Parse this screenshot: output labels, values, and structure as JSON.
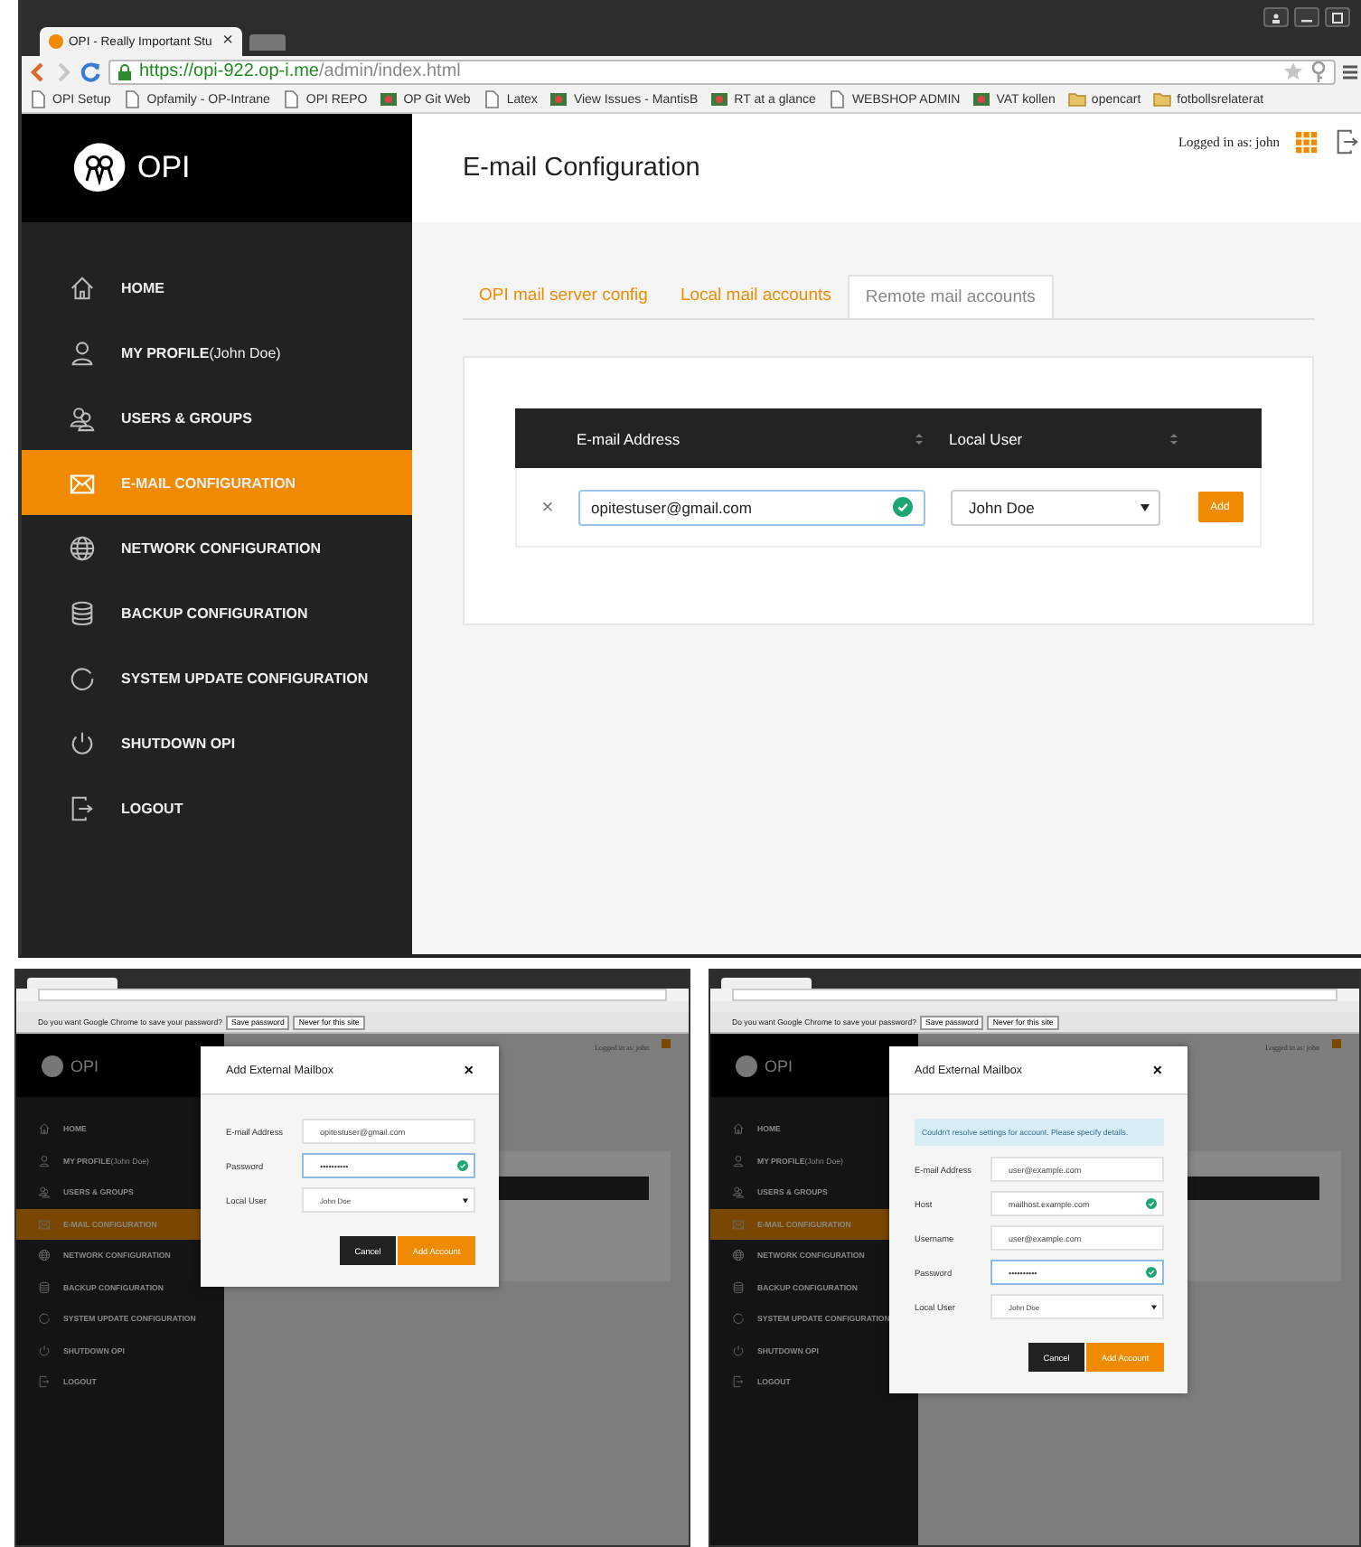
{
  "main": {
    "browser": {
      "tab_title": "OPI - Really Important Stu",
      "tab_close": "×",
      "url_scheme": "https://",
      "url_host": "opi-922.op-i.me",
      "url_path": "/admin/index.html",
      "bookmarks": [
        {
          "label": "OPI Setup",
          "kind": "page"
        },
        {
          "label": "Opfamily - OP-Intrane",
          "kind": "page"
        },
        {
          "label": "OPI REPO",
          "kind": "page"
        },
        {
          "label": "OP Git Web",
          "kind": "site"
        },
        {
          "label": "Latex",
          "kind": "page"
        },
        {
          "label": "View Issues - MantisB",
          "kind": "site"
        },
        {
          "label": "RT at a glance",
          "kind": "site"
        },
        {
          "label": "WEBSHOP ADMIN",
          "kind": "page"
        },
        {
          "label": "VAT kollen",
          "kind": "site"
        },
        {
          "label": "opencart",
          "kind": "folder"
        },
        {
          "label": "fotbollsrelaterat",
          "kind": "folder"
        }
      ]
    },
    "app": {
      "logo": "OPI",
      "logged_in": "Logged in as: john",
      "page_title": "E-mail Configuration",
      "nav": [
        {
          "label": "HOME",
          "kind": "home",
          "selected": false
        },
        {
          "label": "MY PROFILE",
          "note": "(John Doe)",
          "kind": "user",
          "selected": false
        },
        {
          "label": "USERS & GROUPS",
          "kind": "users",
          "selected": false
        },
        {
          "label": "E-MAIL CONFIGURATION",
          "kind": "mail",
          "selected": true
        },
        {
          "label": "NETWORK CONFIGURATION",
          "kind": "globe",
          "selected": false
        },
        {
          "label": "BACKUP CONFIGURATION",
          "kind": "database",
          "selected": false
        },
        {
          "label": "SYSTEM UPDATE CONFIGURATION",
          "kind": "refresh",
          "selected": false
        },
        {
          "label": "SHUTDOWN OPI",
          "kind": "power",
          "selected": false
        },
        {
          "label": "LOGOUT",
          "kind": "logout",
          "selected": false
        }
      ],
      "tabs": [
        {
          "label": "OPI mail server config",
          "selected": false
        },
        {
          "label": "Local mail accounts",
          "selected": false
        },
        {
          "label": "Remote mail accounts",
          "selected": true
        }
      ],
      "table": {
        "columns": [
          "E-mail Address",
          "Local User"
        ],
        "row": {
          "remove": "×",
          "email": "opitestuser@gmail.com",
          "email_valid": true,
          "user": "John Doe",
          "add": "Add"
        }
      }
    }
  },
  "screens": [
    {
      "password_prompt": {
        "question": "Do you want Google Chrome to save your password?",
        "save": "Save password",
        "never": "Never for this site"
      },
      "logo": "OPI",
      "logged_in": "Logged in as: john",
      "nav": [
        {
          "label": "HOME",
          "kind": "home",
          "selected": false
        },
        {
          "label": "MY PROFILE",
          "note": "(John Doe)",
          "kind": "user",
          "selected": false
        },
        {
          "label": "USERS & GROUPS",
          "kind": "users",
          "selected": false
        },
        {
          "label": "E-MAIL CONFIGURATION",
          "kind": "mail",
          "selected": true
        },
        {
          "label": "NETWORK CONFIGURATION",
          "kind": "globe",
          "selected": false
        },
        {
          "label": "BACKUP CONFIGURATION",
          "kind": "database",
          "selected": false
        },
        {
          "label": "SYSTEM UPDATE CONFIGURATION",
          "kind": "refresh",
          "selected": false
        },
        {
          "label": "SHUTDOWN OPI",
          "kind": "power",
          "selected": false
        },
        {
          "label": "LOGOUT",
          "kind": "logout",
          "selected": false
        }
      ],
      "dialog": {
        "title": "Add External Mailbox",
        "close": "×",
        "fields": [
          {
            "label": "E-mail Address",
            "kind": "text",
            "value": "opitestuser@gmail.com",
            "valid": false,
            "focused": false
          },
          {
            "label": "Password",
            "kind": "password",
            "value": "••••••••••",
            "valid": true,
            "focused": true
          },
          {
            "label": "Local User",
            "kind": "select",
            "value": "John Doe",
            "valid": false,
            "focused": false
          }
        ],
        "cancel": "Cancel",
        "submit": "Add Account"
      }
    },
    {
      "password_prompt": {
        "question": "Do you want Google Chrome to save your password?",
        "save": "Save password",
        "never": "Never for this site"
      },
      "logo": "OPI",
      "logged_in": "Logged in as: john",
      "nav": [
        {
          "label": "HOME",
          "kind": "home",
          "selected": false
        },
        {
          "label": "MY PROFILE",
          "note": "(John Doe)",
          "kind": "user",
          "selected": false
        },
        {
          "label": "USERS & GROUPS",
          "kind": "users",
          "selected": false
        },
        {
          "label": "E-MAIL CONFIGURATION",
          "kind": "mail",
          "selected": true
        },
        {
          "label": "NETWORK CONFIGURATION",
          "kind": "globe",
          "selected": false
        },
        {
          "label": "BACKUP CONFIGURATION",
          "kind": "database",
          "selected": false
        },
        {
          "label": "SYSTEM UPDATE CONFIGURATION",
          "kind": "refresh",
          "selected": false
        },
        {
          "label": "SHUTDOWN OPI",
          "kind": "power",
          "selected": false
        },
        {
          "label": "LOGOUT",
          "kind": "logout",
          "selected": false
        }
      ],
      "dialog": {
        "title": "Add External Mailbox",
        "close": "×",
        "alert": "Couldn't resolve settings for account. Please specify details.",
        "fields": [
          {
            "label": "E-mail Address",
            "kind": "text",
            "value": "user@example.com",
            "valid": false,
            "focused": false
          },
          {
            "label": "Host",
            "kind": "text",
            "value": "mailhost.example.com",
            "valid": true,
            "focused": false
          },
          {
            "label": "Username",
            "kind": "text",
            "value": "user@example.com",
            "valid": false,
            "focused": false
          },
          {
            "label": "Password",
            "kind": "password",
            "value": "••••••••••",
            "valid": true,
            "focused": true
          },
          {
            "label": "Local User",
            "kind": "select",
            "value": "John Doe",
            "valid": false,
            "focused": false
          }
        ],
        "cancel": "Cancel",
        "submit": "Add Account"
      }
    }
  ]
}
